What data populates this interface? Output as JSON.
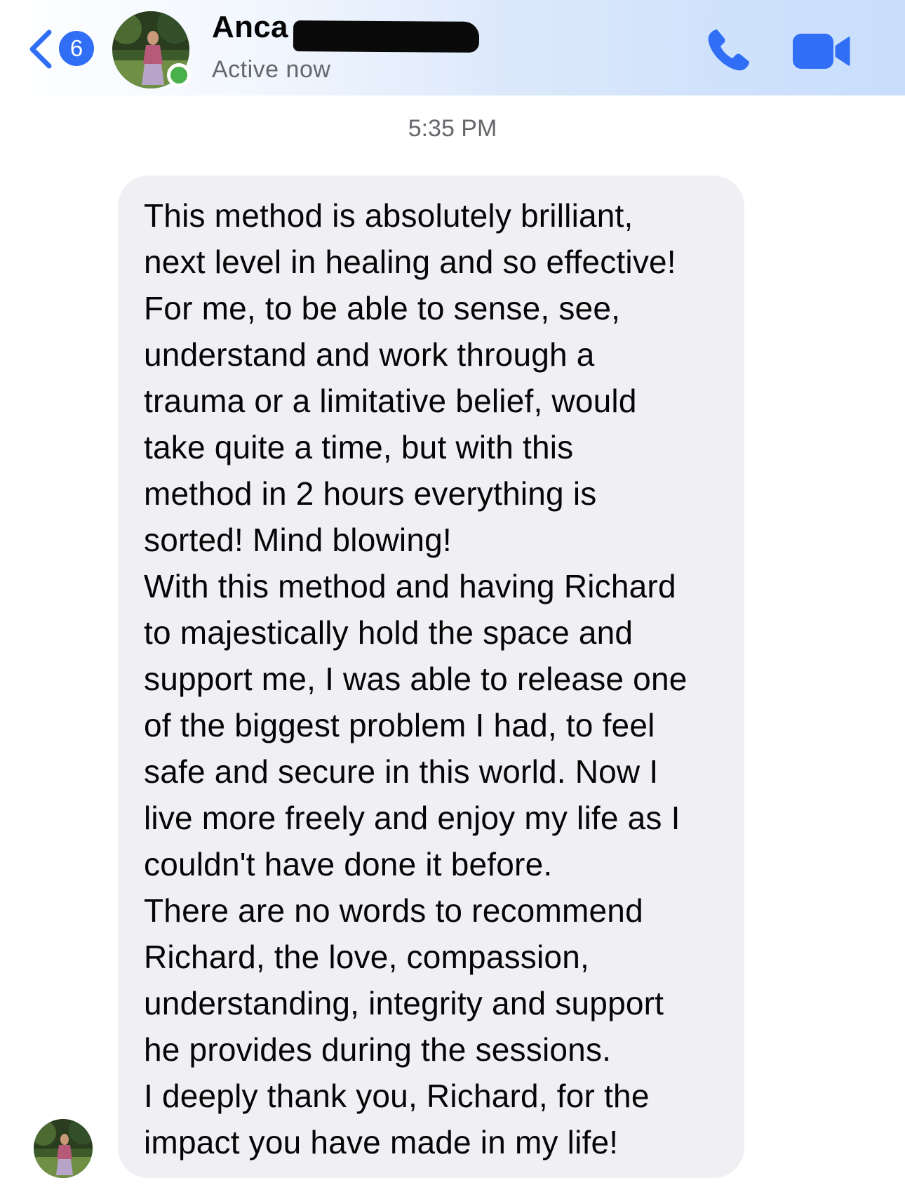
{
  "header": {
    "back_badge_count": "6",
    "contact_name": "Anca",
    "status": "Active now",
    "icons": {
      "back": "chevron-left-icon",
      "call": "phone-icon",
      "video": "video-camera-icon"
    },
    "accent_color": "#2f6ef5",
    "online_color": "#48b14a"
  },
  "thread": {
    "timestamp": "5:35 PM",
    "message": {
      "lines": [
        "This method is absolutely brilliant,",
        "next level in healing and so effective!",
        "For me, to be able to sense, see,",
        "understand and work through a",
        "trauma or a limitative belief,  would",
        "take quite a time,  but with this",
        "method in 2 hours everything is",
        "sorted! Mind blowing!",
        "With this method and having Richard",
        "to majestically hold the space and",
        "support me, I was able to release one",
        "of the biggest problem I had, to feel",
        "safe and secure in this world.  Now I",
        "live more freely and enjoy my life as I",
        "couldn't have done it before.",
        "There are no words to recommend",
        "Richard, the love, compassion,",
        "understanding,  integrity and support",
        "he provides during the sessions.",
        "I deeply thank you, Richard, for the",
        "impact you have made in my life!"
      ]
    },
    "bubble_color": "#f0f0f4"
  }
}
